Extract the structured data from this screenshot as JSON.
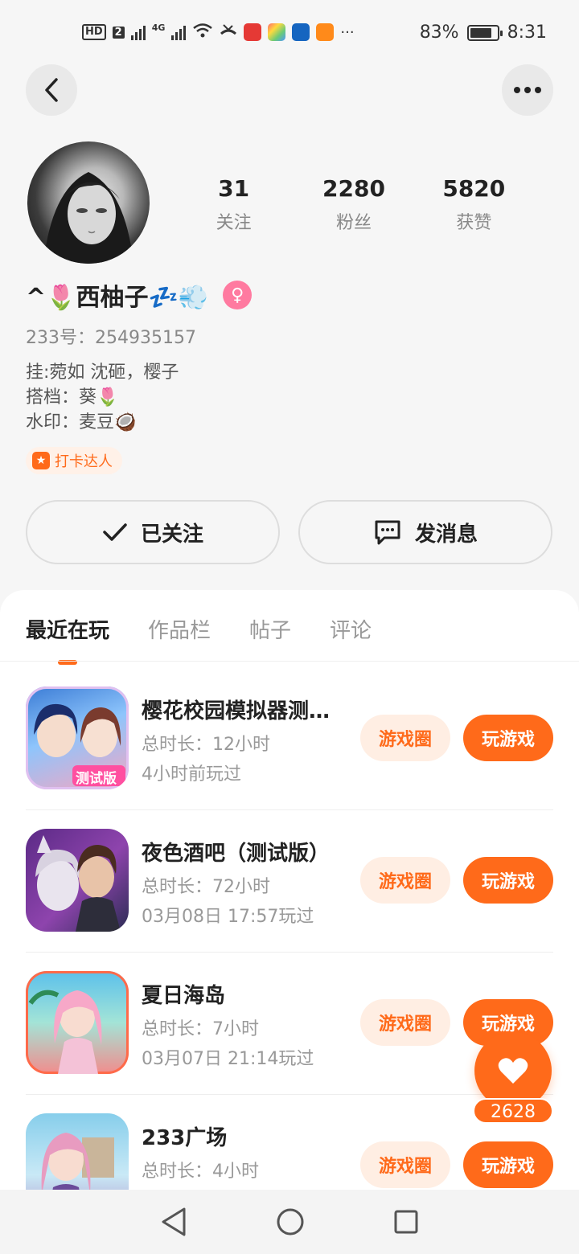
{
  "status_bar": {
    "hd_label": "HD",
    "sim_label": "2",
    "network_label": "4G",
    "more": "···",
    "battery": "83%",
    "battery_level": 0.83,
    "time": "8:31"
  },
  "profile": {
    "stats": [
      {
        "value": "31",
        "label": "关注"
      },
      {
        "value": "2280",
        "label": "粉丝"
      },
      {
        "value": "5820",
        "label": "获赞"
      }
    ],
    "name": "^🌷西柚子💤💨",
    "gender_symbol": "♀",
    "uid": "233号：254935157",
    "bio": [
      "挂:菀如 沈砸，樱子",
      "搭档：葵🌷",
      "水印：麦豆🥥"
    ],
    "badge": "打卡达人"
  },
  "actions": {
    "follow_label": "已关注",
    "message_label": "发消息"
  },
  "tabs": [
    "最近在玩",
    "作品栏",
    "帖子",
    "评论"
  ],
  "games": [
    {
      "title": "樱花校园模拟器测试版",
      "duration": "总时长：12小时",
      "last_played": "4小时前玩过",
      "icon_badge": "测试版"
    },
    {
      "title": "夜色酒吧（测试版）",
      "duration": "总时长：72小时",
      "last_played": "03月08日 17:57玩过"
    },
    {
      "title": "夏日海岛",
      "duration": "总时长：7小时",
      "last_played": "03月07日 21:14玩过"
    },
    {
      "title": "233广场",
      "duration": "总时长：4小时",
      "last_played": ""
    }
  ],
  "game_buttons": {
    "circle": "游戏圈",
    "play": "玩游戏"
  },
  "like": {
    "count": "2628"
  },
  "colors": {
    "accent": "#ff6a1a",
    "accent_light": "#ffeee3"
  }
}
